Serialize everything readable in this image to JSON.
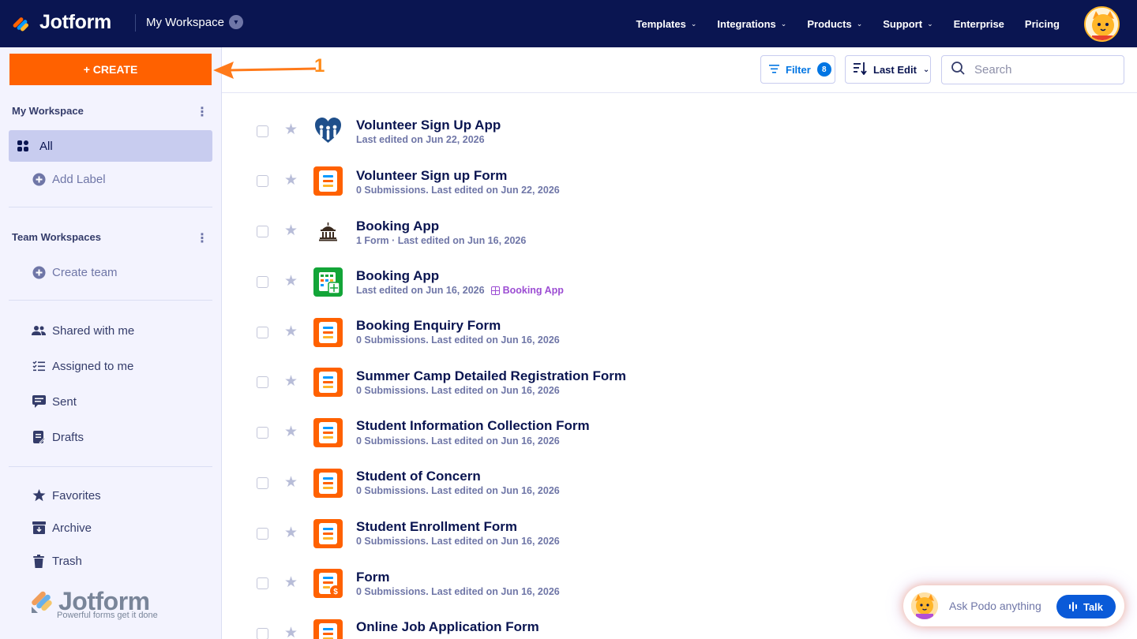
{
  "brand": {
    "logo_text": "Jotform",
    "tagline": "Powerful forms get it done"
  },
  "header": {
    "workspace_title": "My Workspace",
    "nav": [
      {
        "label": "Templates",
        "has_dropdown": true
      },
      {
        "label": "Integrations",
        "has_dropdown": true
      },
      {
        "label": "Products",
        "has_dropdown": true
      },
      {
        "label": "Support",
        "has_dropdown": true
      },
      {
        "label": "Enterprise",
        "has_dropdown": false
      },
      {
        "label": "Pricing",
        "has_dropdown": false
      }
    ]
  },
  "annotation": {
    "number": "1"
  },
  "sidebar": {
    "create_label": "+ CREATE",
    "my_workspace_heading": "My Workspace",
    "all_label": "All",
    "add_label": "Add Label",
    "team_heading": "Team Workspaces",
    "create_team": "Create team",
    "shared_with_me": "Shared with me",
    "assigned_to_me": "Assigned to me",
    "sent": "Sent",
    "drafts": "Drafts",
    "favorites": "Favorites",
    "archive": "Archive",
    "trash": "Trash"
  },
  "toolbar": {
    "filter_label": "Filter",
    "filter_count": "8",
    "sort_label": "Last Edit",
    "search_placeholder": "Search"
  },
  "items": [
    {
      "title": "Volunteer Sign Up App",
      "subtitle": "Last edited on Jun 22, 2026",
      "icon": "volunteer-app-icon"
    },
    {
      "title": "Volunteer Sign up Form",
      "subtitle": "0 Submissions. Last edited on Jun 22, 2026",
      "icon": "form-icon"
    },
    {
      "title": "Booking App",
      "subtitle": "1 Form · Last edited on Jun 16, 2026",
      "icon": "building-app-icon"
    },
    {
      "title": "Booking App",
      "subtitle": "Last edited on Jun 16, 2026",
      "tag": "Booking App",
      "icon": "table-icon"
    },
    {
      "title": "Booking Enquiry Form",
      "subtitle": "0 Submissions. Last edited on Jun 16, 2026",
      "icon": "form-icon"
    },
    {
      "title": "Summer Camp Detailed Registration Form",
      "subtitle": "0 Submissions. Last edited on Jun 16, 2026",
      "icon": "form-icon"
    },
    {
      "title": "Student Information Collection Form",
      "subtitle": "0 Submissions. Last edited on Jun 16, 2026",
      "icon": "form-icon"
    },
    {
      "title": "Student of Concern",
      "subtitle": "0 Submissions. Last edited on Jun 16, 2026",
      "icon": "form-icon"
    },
    {
      "title": "Student Enrollment Form",
      "subtitle": "0 Submissions. Last edited on Jun 16, 2026",
      "icon": "form-icon"
    },
    {
      "title": "Form",
      "subtitle": "0 Submissions. Last edited on Jun 16, 2026",
      "icon": "payment-form-icon"
    },
    {
      "title": "Online Job Application Form",
      "subtitle": "",
      "icon": "form-icon"
    }
  ],
  "podo": {
    "prompt": "Ask Podo anything",
    "talk_label": "Talk"
  },
  "colors": {
    "navy": "#0a1551",
    "orange": "#ff6100",
    "blue": "#0075e3",
    "sidebar_bg": "#f3f3fe",
    "active": "#c8ccef",
    "purple": "#9c4dd3"
  }
}
